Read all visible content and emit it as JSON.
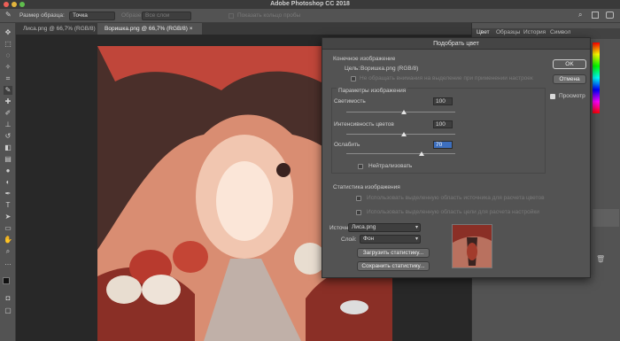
{
  "window": {
    "title": "Adobe Photoshop CC 2018"
  },
  "options_bar": {
    "sample_size_label": "Размер образца:",
    "sample_size_value": "Точка",
    "sample_label": "Образец:",
    "sample_value": "Все слои",
    "show_ring_label": "Показать кольцо пробы"
  },
  "tabs": [
    {
      "label": "Лиса.png @ 66,7% (RGB/8)"
    },
    {
      "label": "Воришка.png @ 66,7% (RGB/8) ×"
    }
  ],
  "right_panel": {
    "tabs": [
      "Цвет",
      "Образцы",
      "История",
      "Символ"
    ]
  },
  "dialog": {
    "title": "Подобрать цвет",
    "target_section": "Конечное изображение",
    "target_label": "Цель:",
    "target_value": "Воришка.png (RGB/8)",
    "ignore_selection": "Не обращать внимания на выделение при применении настроек",
    "image_params": "Параметры изображения",
    "luminance_label": "Светимость",
    "luminance_value": "100",
    "color_intensity_label": "Интенсивность цветов",
    "color_intensity_value": "100",
    "fade_label": "Ослабить",
    "fade_value": "70",
    "neutralize_label": "Нейтрализовать",
    "stats_section": "Статистика изображения",
    "use_source_selection": "Использовать выделенную область источника для расчета цветов",
    "use_target_selection": "Использовать выделенную область цели для расчета настройки",
    "source_label": "Источник:",
    "source_value": "Лиса.png",
    "layer_label": "Слой:",
    "layer_value": "Фон",
    "load_stats": "Загрузить статистику...",
    "save_stats": "Сохранить статистику...",
    "ok": "OK",
    "cancel": "Отмена",
    "preview_label": "Просмотр",
    "preview_checked": true
  }
}
